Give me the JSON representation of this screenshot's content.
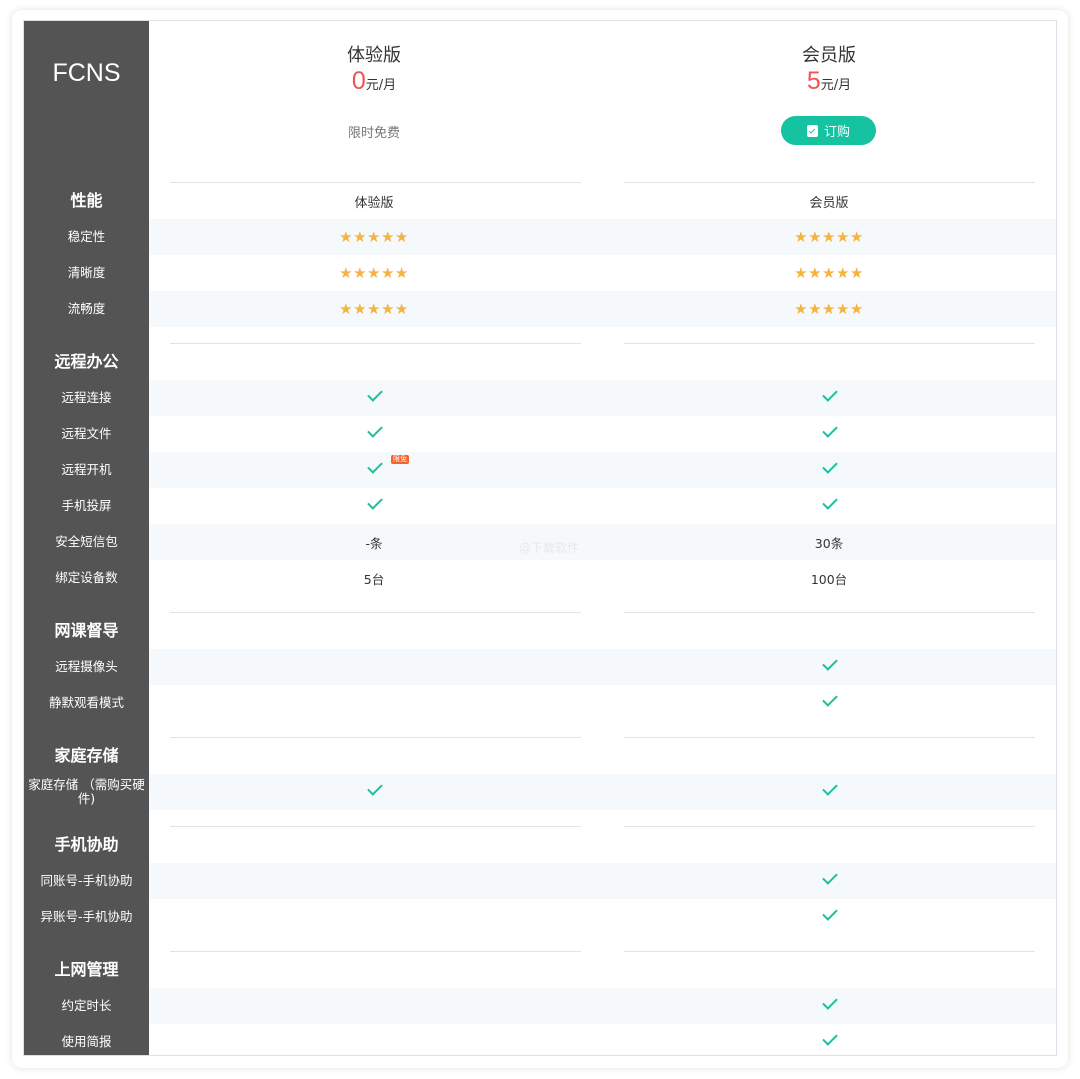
{
  "brand": "FCNS",
  "plans": [
    {
      "name": "体验版",
      "price": "0",
      "unit": "元/月",
      "promo": "限时免费"
    },
    {
      "name": "会员版",
      "price": "5",
      "unit": "元/月",
      "button": "订购"
    }
  ],
  "column_headers": [
    "体验版",
    "会员版"
  ],
  "sections": [
    {
      "title": "性能",
      "rows": [
        {
          "label": "稳定性",
          "values": [
            "★★★★★",
            "★★★★★"
          ],
          "ratings": [
            5,
            5
          ]
        },
        {
          "label": "清晰度",
          "values": [
            "★★★★★",
            "★★★★★"
          ],
          "ratings": [
            5,
            5
          ]
        },
        {
          "label": "流畅度",
          "values": [
            "★★★★★",
            "★★★★★"
          ],
          "ratings": [
            5,
            5
          ]
        }
      ]
    },
    {
      "title": "远程办公",
      "rows": [
        {
          "label": "远程连接",
          "values": [
            "check",
            "check"
          ]
        },
        {
          "label": "远程文件",
          "values": [
            "check",
            "check"
          ]
        },
        {
          "label": "远程开机",
          "values": [
            "check",
            "check"
          ],
          "badge": "限免"
        },
        {
          "label": "手机投屏",
          "values": [
            "check",
            "check"
          ]
        },
        {
          "label": "安全短信包",
          "values": [
            "-条",
            "30条"
          ]
        },
        {
          "label": "绑定设备数",
          "values": [
            "5台",
            "100台"
          ]
        }
      ]
    },
    {
      "title": "网课督导",
      "rows": [
        {
          "label": "远程摄像头",
          "values": [
            "",
            "check"
          ]
        },
        {
          "label": "静默观看模式",
          "values": [
            "",
            "check"
          ]
        }
      ]
    },
    {
      "title": "家庭存储",
      "rows": [
        {
          "label": "家庭存储 （需购买硬件)",
          "values": [
            "check",
            "check"
          ]
        }
      ]
    },
    {
      "title": "手机协助",
      "rows": [
        {
          "label": "同账号-手机协助",
          "values": [
            "",
            "check"
          ]
        },
        {
          "label": "异账号-手机协助",
          "values": [
            "",
            "check"
          ]
        }
      ]
    },
    {
      "title": "上网管理",
      "rows": [
        {
          "label": "约定时长",
          "values": [
            "",
            "check"
          ]
        },
        {
          "label": "使用简报",
          "values": [
            "",
            "check"
          ]
        }
      ]
    }
  ],
  "watermark": "@下载软件",
  "colors": {
    "sidebar": "#545454",
    "accent": "#16c3a1",
    "price": "#f05454",
    "star": "#f5b33f"
  },
  "icons": {
    "button": "clipboard-check-icon",
    "available": "check-icon",
    "rating": "star-icon"
  }
}
